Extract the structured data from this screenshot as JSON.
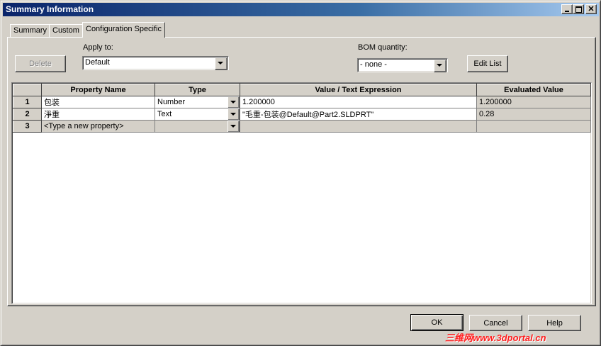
{
  "window": {
    "title": "Summary Information"
  },
  "tabs": [
    {
      "label": "Summary",
      "active": false
    },
    {
      "label": "Custom",
      "active": false
    },
    {
      "label": "Configuration Specific",
      "active": true
    }
  ],
  "toolbar": {
    "delete_label": "Delete",
    "apply_to_label": "Apply to:",
    "apply_to_value": "Default",
    "bom_label": "BOM quantity:",
    "bom_value": "- none -",
    "edit_list_label": "Edit List"
  },
  "grid": {
    "columns": [
      "Property Name",
      "Type",
      "Value / Text Expression",
      "Evaluated Value"
    ],
    "rows": [
      {
        "num": "1",
        "name": "包装",
        "type": "Number",
        "value": "1.200000",
        "evaluated": "1.200000"
      },
      {
        "num": "2",
        "name": "淨重",
        "type": "Text",
        "value": "\"毛重-包装@Default@Part2.SLDPRT\"",
        "evaluated": "0.28"
      },
      {
        "num": "3",
        "name": "<Type a new property>",
        "type": "",
        "value": "",
        "evaluated": ""
      }
    ]
  },
  "footer": {
    "ok_label": "OK",
    "cancel_label": "Cancel",
    "help_label": "Help"
  },
  "watermark": "三维网www.3dportal.cn"
}
